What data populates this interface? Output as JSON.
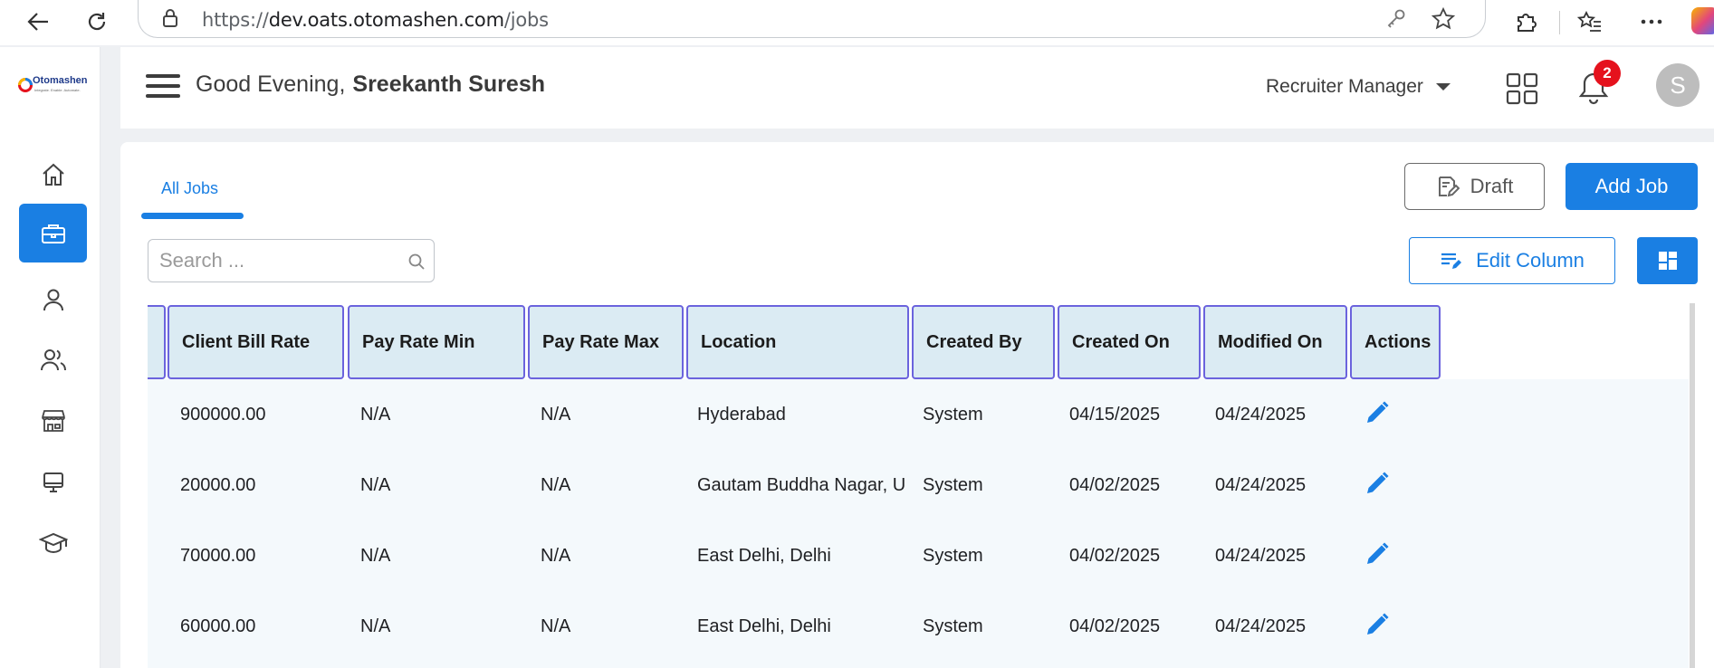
{
  "browser": {
    "url_prefix": "https://",
    "url_host": "dev.oats.otomashen.com",
    "url_path": "/jobs"
  },
  "logo": {
    "name": "Otomashen",
    "tagline": "Integrate. Enable. Automate."
  },
  "header": {
    "greeting": "Good Evening,",
    "user_name": "Sreekanth Suresh",
    "role": "Recruiter Manager",
    "notification_count": "2",
    "avatar_initial": "S"
  },
  "sidebar": {
    "items": [
      {
        "icon": "home-icon",
        "active": false
      },
      {
        "icon": "briefcase-icon",
        "active": true
      },
      {
        "icon": "user-icon",
        "active": false
      },
      {
        "icon": "users-icon",
        "active": false
      },
      {
        "icon": "store-icon",
        "active": false
      },
      {
        "icon": "monitor-icon",
        "active": false
      },
      {
        "icon": "graduation-cap-icon",
        "active": false
      }
    ]
  },
  "main": {
    "tabs": [
      {
        "label": "All Jobs",
        "active": true
      }
    ],
    "draft_label": "Draft",
    "add_job_label": "Add Job",
    "search_placeholder": "Search ...",
    "edit_column_label": "Edit Column"
  },
  "table": {
    "columns": [
      "Client Bill Rate",
      "Pay Rate Min",
      "Pay Rate Max",
      "Location",
      "Created By",
      "Created On",
      "Modified On",
      "Actions"
    ],
    "rows": [
      [
        "900000.00",
        "N/A",
        "N/A",
        "Hyderabad",
        "System",
        "04/15/2025",
        "04/24/2025"
      ],
      [
        "20000.00",
        "N/A",
        "N/A",
        "Gautam Buddha Nagar, Utt...",
        "System",
        "04/02/2025",
        "04/24/2025"
      ],
      [
        "70000.00",
        "N/A",
        "N/A",
        "East Delhi, Delhi",
        "System",
        "04/02/2025",
        "04/24/2025"
      ],
      [
        "60000.00",
        "N/A",
        "N/A",
        "East Delhi, Delhi",
        "System",
        "04/02/2025",
        "04/24/2025"
      ]
    ]
  },
  "colors": {
    "accent": "#1a7fe3",
    "header_bg": "#dbebf3",
    "header_border": "#6b63dd",
    "row_bg": "#f4f9fc",
    "badge": "#e5121d"
  }
}
